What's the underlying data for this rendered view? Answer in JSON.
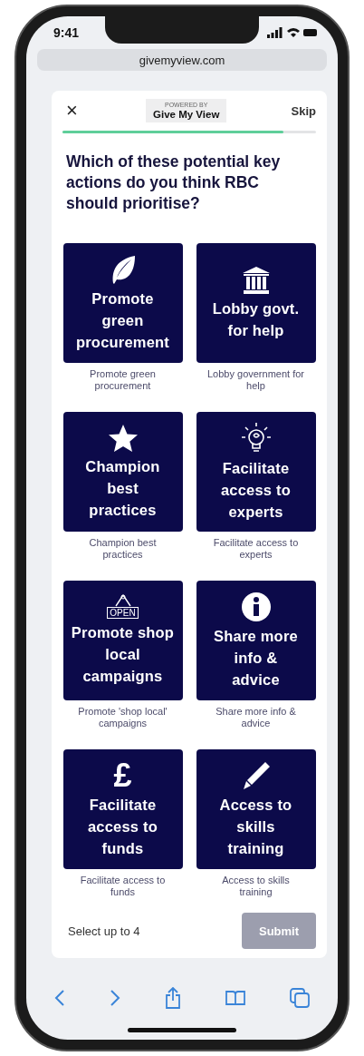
{
  "status_bar": {
    "time": "9:41"
  },
  "browser": {
    "url": "givemyview.com"
  },
  "header": {
    "close": "×",
    "powered_by": "POWERED BY",
    "brand": "Give My View",
    "skip": "Skip",
    "progress": {
      "level": 0.87
    }
  },
  "question": "Which of these potential key actions do you think RBC should prioritise?",
  "options": [
    {
      "kind": "leaf",
      "title": "Promote\ngreen\nprocurement",
      "caption": "Promote green procurement",
      "selected": false
    },
    {
      "kind": "bank",
      "title": "Lobby govt.\nfor help",
      "caption": "Lobby government for help",
      "selected": false
    },
    {
      "kind": "star",
      "title": "Champion\nbest\npractices",
      "caption": "Champion best practices",
      "selected": false
    },
    {
      "kind": "bulb",
      "title": "Facilitate\naccess to\nexperts",
      "caption": "Facilitate access to experts",
      "selected": false
    },
    {
      "kind": "sign",
      "sign_text": "OPEN",
      "title": "Promote shop\nlocal\ncampaigns",
      "caption": "Promote 'shop local' campaigns",
      "selected": false
    },
    {
      "kind": "info",
      "title": "Share more\ninfo &\nadvice",
      "caption": "Share more info & advice",
      "selected": false
    },
    {
      "kind": "glyph",
      "glyph": "£",
      "title": "Facilitate\naccess to\nfunds",
      "caption": "Facilitate access to funds",
      "selected": false
    },
    {
      "kind": "pen",
      "title": "Access to\nskills\ntraining",
      "caption": "Access to skills training",
      "selected": false
    }
  ],
  "footer": {
    "hint": "Select up to 4",
    "submit": {
      "label": "Submit",
      "disabled": true
    }
  }
}
